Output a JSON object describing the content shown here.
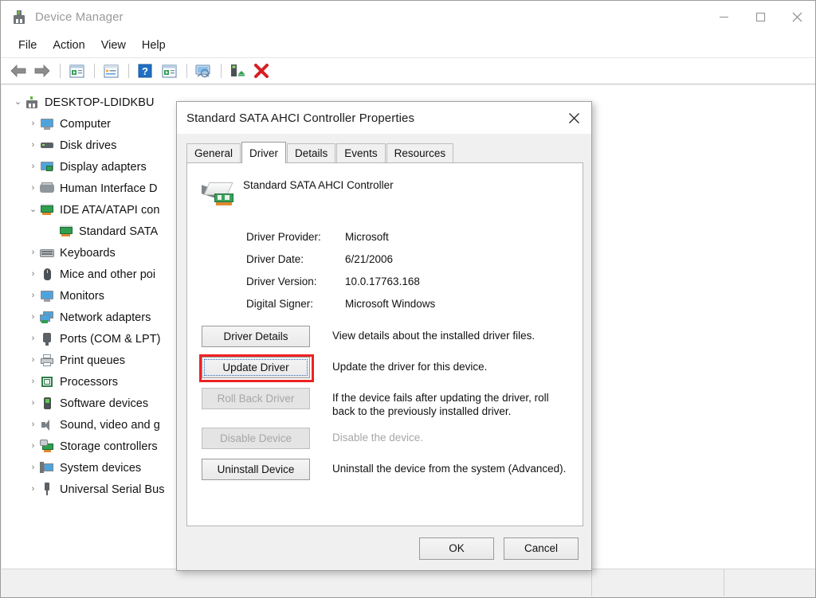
{
  "window": {
    "title": "Device Manager",
    "icon": "device-manager-icon",
    "controls": {
      "minimize": "—",
      "maximize": "□",
      "close": "✕"
    }
  },
  "menubar": {
    "items": [
      {
        "label": "File"
      },
      {
        "label": "Action"
      },
      {
        "label": "View"
      },
      {
        "label": "Help"
      }
    ]
  },
  "toolbar": {
    "buttons": [
      {
        "name": "back-arrow-icon"
      },
      {
        "name": "forward-arrow-icon"
      },
      {
        "name": "show-hide-console-tree-icon"
      },
      {
        "name": "properties-icon"
      },
      {
        "name": "help-icon"
      },
      {
        "name": "scan-for-hardware-changes-icon"
      },
      {
        "name": "update-driver-icon"
      },
      {
        "name": "disable-device-icon"
      },
      {
        "name": "uninstall-device-icon"
      }
    ]
  },
  "tree": {
    "nodes": [
      {
        "label": "DESKTOP-LDIDKBU",
        "level": 0,
        "expanded": true,
        "chevron": "⌄",
        "icon": "computer-root-icon"
      },
      {
        "label": "Computer",
        "level": 1,
        "expanded": false,
        "chevron": "›",
        "icon": "monitor-icon"
      },
      {
        "label": "Disk drives",
        "level": 1,
        "expanded": false,
        "chevron": "›",
        "icon": "disk-drive-icon"
      },
      {
        "label": "Display adapters",
        "level": 1,
        "expanded": false,
        "chevron": "›",
        "icon": "display-adapter-icon"
      },
      {
        "label": "Human Interface D",
        "level": 1,
        "expanded": false,
        "chevron": "›",
        "icon": "human-interface-device-icon"
      },
      {
        "label": "IDE ATA/ATAPI con",
        "level": 1,
        "expanded": true,
        "chevron": "⌄",
        "icon": "ide-controller-icon"
      },
      {
        "label": "Standard SATA",
        "level": 2,
        "expanded": false,
        "chevron": "",
        "icon": "sata-controller-icon"
      },
      {
        "label": "Keyboards",
        "level": 1,
        "expanded": false,
        "chevron": "›",
        "icon": "keyboard-icon"
      },
      {
        "label": "Mice and other poi",
        "level": 1,
        "expanded": false,
        "chevron": "›",
        "icon": "mouse-icon"
      },
      {
        "label": "Monitors",
        "level": 1,
        "expanded": false,
        "chevron": "›",
        "icon": "monitor-icon"
      },
      {
        "label": "Network adapters",
        "level": 1,
        "expanded": false,
        "chevron": "›",
        "icon": "network-adapter-icon"
      },
      {
        "label": "Ports (COM & LPT)",
        "level": 1,
        "expanded": false,
        "chevron": "›",
        "icon": "port-icon"
      },
      {
        "label": "Print queues",
        "level": 1,
        "expanded": false,
        "chevron": "›",
        "icon": "printer-icon"
      },
      {
        "label": "Processors",
        "level": 1,
        "expanded": false,
        "chevron": "›",
        "icon": "processor-icon"
      },
      {
        "label": "Software devices",
        "level": 1,
        "expanded": false,
        "chevron": "›",
        "icon": "software-device-icon"
      },
      {
        "label": "Sound, video and g",
        "level": 1,
        "expanded": false,
        "chevron": "›",
        "icon": "sound-device-icon"
      },
      {
        "label": "Storage controllers",
        "level": 1,
        "expanded": false,
        "chevron": "›",
        "icon": "storage-controller-icon"
      },
      {
        "label": "System devices",
        "level": 1,
        "expanded": false,
        "chevron": "›",
        "icon": "system-device-icon"
      },
      {
        "label": "Universal Serial Bus",
        "level": 1,
        "expanded": false,
        "chevron": "›",
        "icon": "usb-icon"
      }
    ]
  },
  "dialog": {
    "title": "Standard SATA AHCI Controller Properties",
    "close_glyph": "✕",
    "tabs": [
      {
        "label": "General",
        "selected": false
      },
      {
        "label": "Driver",
        "selected": true
      },
      {
        "label": "Details",
        "selected": false
      },
      {
        "label": "Events",
        "selected": false
      },
      {
        "label": "Resources",
        "selected": false
      }
    ],
    "device_name": "Standard SATA AHCI Controller",
    "device_icon": "pci-card-icon",
    "info": [
      {
        "key": "Driver Provider:",
        "value": "Microsoft"
      },
      {
        "key": "Driver Date:",
        "value": "6/21/2006"
      },
      {
        "key": "Driver Version:",
        "value": "10.0.17763.168"
      },
      {
        "key": "Digital Signer:",
        "value": "Microsoft Windows"
      }
    ],
    "actions": [
      {
        "label": "Driver Details",
        "accel_index": 2,
        "description": "View details about the installed driver files.",
        "disabled": false,
        "focused": false,
        "highlighted": false
      },
      {
        "label": "Update Driver",
        "accel_index": 2,
        "description": "Update the driver for this device.",
        "disabled": false,
        "focused": true,
        "highlighted": true
      },
      {
        "label": "Roll Back Driver",
        "accel_index": 0,
        "description": "If the device fails after updating the driver, roll back to the previously installed driver.",
        "disabled": true,
        "focused": false,
        "highlighted": false
      },
      {
        "label": "Disable Device",
        "accel_index": 0,
        "description": "Disable the device.",
        "disabled": true,
        "focused": false,
        "highlighted": false
      },
      {
        "label": "Uninstall Device",
        "accel_index": 0,
        "description": "Uninstall the device from the system (Advanced).",
        "disabled": false,
        "focused": false,
        "highlighted": false
      }
    ],
    "footer": {
      "ok": "OK",
      "cancel": "Cancel"
    }
  },
  "colors": {
    "highlight_red": "#ee2222",
    "focus_blue": "#2f6bbf",
    "titlebar_bg": "#ffffff",
    "dialog_bg": "#f0f0f0",
    "tree_bg": "#ffffff"
  }
}
